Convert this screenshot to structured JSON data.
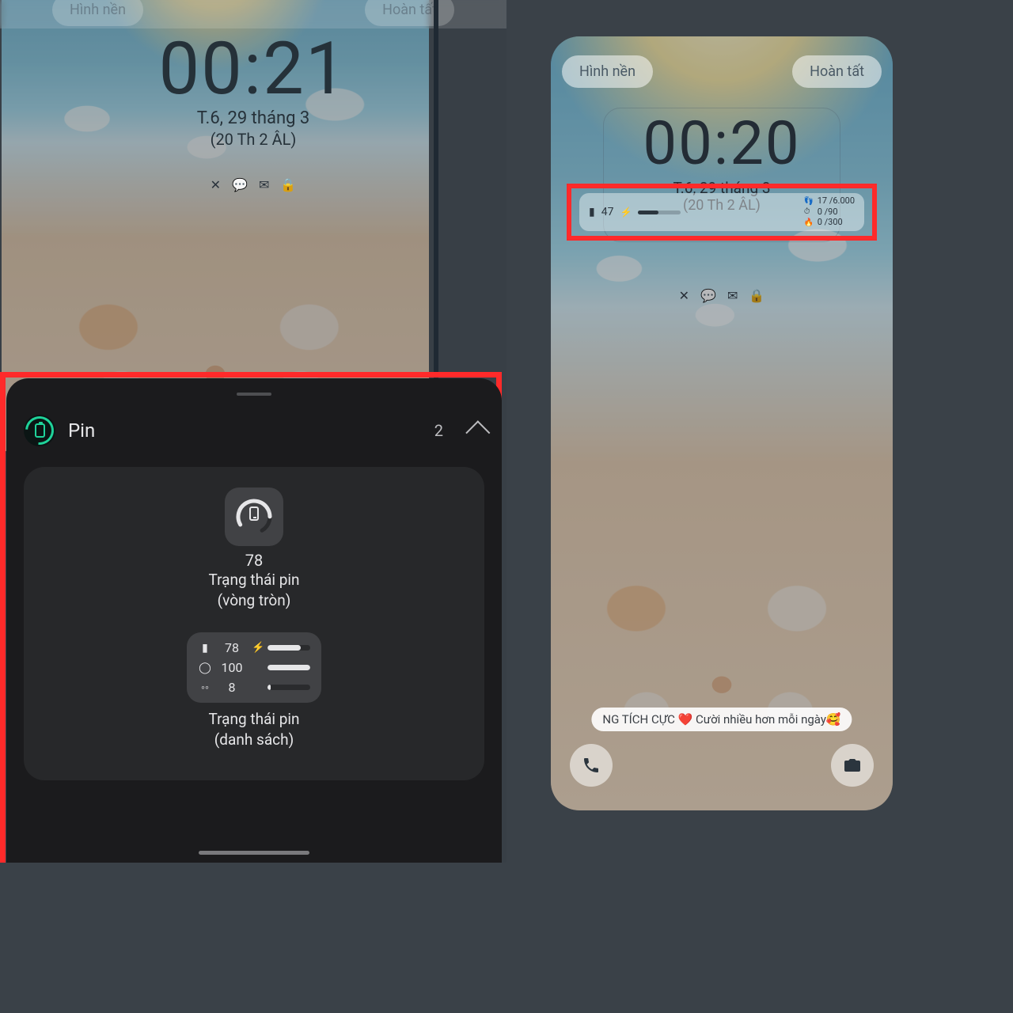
{
  "left": {
    "top_ghost_left": "Hình nền",
    "top_ghost_right": "Hoàn tất",
    "clock": {
      "time": "00:21",
      "date": "T.6, 29 tháng 3",
      "lunar": "(20 Th 2 ÂL)"
    },
    "sheet": {
      "title": "Pin",
      "count": "2",
      "circle": {
        "value": "78",
        "label_line1": "Trạng thái pin",
        "label_line2": "(vòng tròn)"
      },
      "list": {
        "rows": [
          {
            "icon": "phone-icon",
            "glyph": "▮",
            "value": "78",
            "bolt": "⚡",
            "fill": 78
          },
          {
            "icon": "watch-icon",
            "glyph": "◯",
            "value": "100",
            "bolt": "",
            "fill": 100
          },
          {
            "icon": "buds-icon",
            "glyph": "◦◦",
            "value": "8",
            "bolt": "",
            "fill": 8
          }
        ],
        "label_line1": "Trạng thái pin",
        "label_line2": "(danh sách)"
      }
    }
  },
  "right": {
    "btn_left": "Hình nền",
    "btn_right": "Hoàn tất",
    "clock": {
      "time": "00:20",
      "date": "T.6, 29 tháng 3",
      "lunar": "(20 Th 2 ÂL)"
    },
    "widget": {
      "battery_value": "47",
      "stats": [
        {
          "icon": "steps-icon",
          "glyph": "👣",
          "text": "17 /6.000"
        },
        {
          "icon": "activity-icon",
          "glyph": "⏱",
          "text": "0 /90"
        },
        {
          "icon": "calories-icon",
          "glyph": "🔥",
          "text": "0 /300"
        }
      ]
    },
    "banner": "NG TÍCH CỰC ❤️ Cười nhiều hơn mỗi ngày🥰"
  }
}
